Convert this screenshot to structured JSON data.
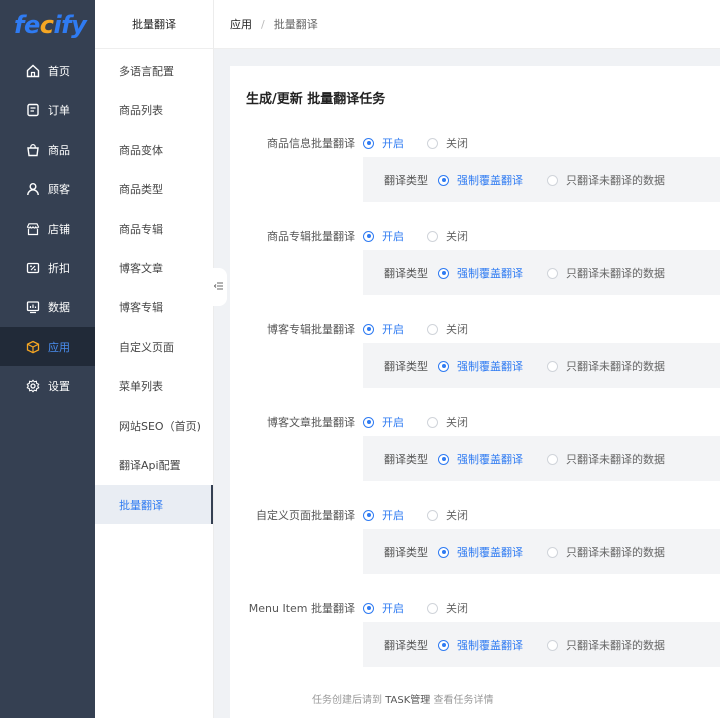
{
  "logo": {
    "text_a": "fe",
    "text_b": "c",
    "text_c": "ify"
  },
  "nav": [
    {
      "label": "首页",
      "icon": "home-icon"
    },
    {
      "label": "订单",
      "icon": "order-icon"
    },
    {
      "label": "商品",
      "icon": "bag-icon"
    },
    {
      "label": "顾客",
      "icon": "user-icon"
    },
    {
      "label": "店铺",
      "icon": "store-icon"
    },
    {
      "label": "折扣",
      "icon": "discount-icon"
    },
    {
      "label": "数据",
      "icon": "chart-icon"
    },
    {
      "label": "应用",
      "icon": "box-icon",
      "active": true
    },
    {
      "label": "设置",
      "icon": "gear-icon"
    }
  ],
  "sub": {
    "title": "批量翻译",
    "items": [
      "多语言配置",
      "商品列表",
      "商品变体",
      "商品类型",
      "商品专辑",
      "博客文章",
      "博客专辑",
      "自定义页面",
      "菜单列表",
      "网站SEO（首页)",
      "翻译Api配置",
      "批量翻译"
    ]
  },
  "breadcrumb": {
    "app": "应用",
    "sep": "/",
    "current": "批量翻译"
  },
  "panel": {
    "title": "生成/更新 批量翻译任务"
  },
  "options": {
    "on": "开启",
    "off": "关闭",
    "type_label": "翻译类型",
    "overwrite": "强制覆盖翻译",
    "untranslated": "只翻译未翻译的数据"
  },
  "rows": [
    {
      "label": "商品信息批量翻译"
    },
    {
      "label": "商品专辑批量翻译"
    },
    {
      "label": "博客专辑批量翻译"
    },
    {
      "label": "博客文章批量翻译"
    },
    {
      "label": "自定义页面批量翻译"
    },
    {
      "label": "Menu Item 批量翻译"
    }
  ],
  "footer": {
    "pre": "任务创建后请到 ",
    "link": "TASK管理",
    "post": " 查看任务详情"
  },
  "colors": {
    "nav_bg": "#354052",
    "accent": "#2f7bf2",
    "logo_orange": "#f5a623"
  }
}
